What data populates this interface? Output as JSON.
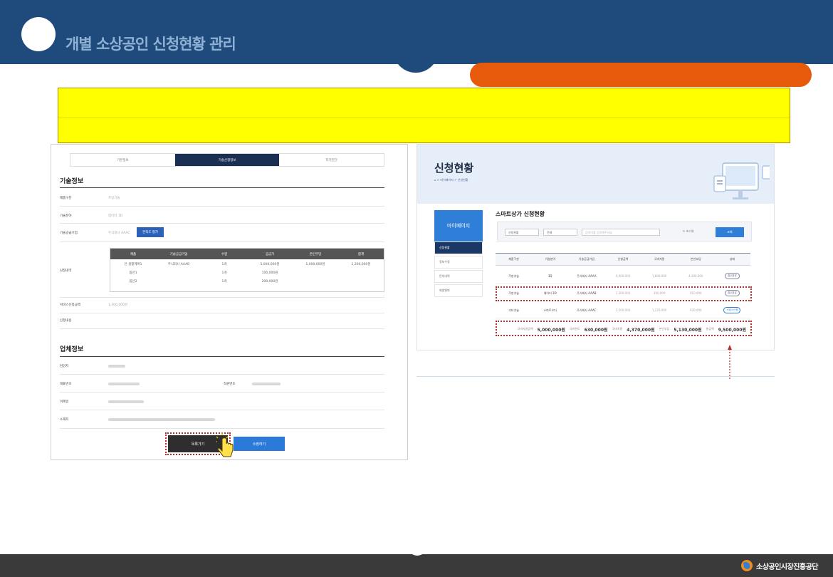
{
  "header": {
    "title": "개별 소상공인 신청현황 관리"
  },
  "left_panel": {
    "tabs": [
      "기본정보",
      "기술신청정보",
      "자가진단"
    ],
    "active_tab": 1,
    "tech_section_title": "기술정보",
    "rows": [
      {
        "label": "제품구분",
        "value": "주방기술"
      },
      {
        "label": "기술분야",
        "value": "데이터 3D"
      },
      {
        "label": "기술공급기업",
        "value": "주식회사 AAAC"
      },
      {
        "label": "신청내역",
        "value": ""
      },
      {
        "label": "서비스신청금액",
        "value": "1,300,000원"
      },
      {
        "label": "신청내용",
        "value": ""
      }
    ],
    "compare_button": "견적도 평가",
    "table": {
      "headers": [
        "제품",
        "기술공급기업",
        "수량",
        "공급가",
        "본인부담",
        "합계"
      ],
      "rows": [
        [
          "안 생활계획1",
          "주식회사 AAAB",
          "1개",
          "5,000,000원",
          "1,000,000원",
          "1,300,000원"
        ],
        [
          "옵션1",
          "",
          "1개",
          "100,000원",
          "",
          ""
        ],
        [
          "옵션2",
          "",
          "1개",
          "200,000원",
          "",
          ""
        ]
      ]
    },
    "company_section_title": "업체정보",
    "company_rows": [
      "담당자",
      "대표번호",
      "직원번호",
      "이메일",
      "소재지"
    ],
    "back_button": "목록가기",
    "edit_button": "수정하기"
  },
  "right_panel": {
    "title": "신청현황",
    "breadcrumb": "⌂ > 마이페이지 > 신청현황",
    "side_menu_title": "마이페이지",
    "side_items": [
      "신청현황",
      "정보수정",
      "문의내역",
      "회원탈퇴"
    ],
    "subtitle": "스마트상가 신청현황",
    "filters": [
      "신청현황",
      "전체",
      "검색어를 입력해주세요"
    ],
    "reset_label": "↻ 초기화",
    "search_button": "조회",
    "table_headers": [
      "제품구분",
      "기술분야",
      "기술공급기업",
      "신청금액",
      "국비지원",
      "본인부담",
      "상태"
    ],
    "rows": [
      [
        "주방기술",
        "3D",
        "주식회사 AAAA",
        "6,000,000",
        "1,800,000",
        "4,200,000",
        "접수완료"
      ],
      [
        "주방기술",
        "데이터 3D",
        "주식회사 AAAB",
        "1,300,000",
        "390,000",
        "910,000",
        "접수완료"
      ],
      [
        "기타기술",
        "스마트오더",
        "주식회사 AAAC",
        "2,200,000",
        "1,270,000",
        "930,000",
        "서비스신청"
      ]
    ],
    "totals": [
      {
        "label": "국비지원금액",
        "value": "5,000,000원"
      },
      {
        "label": "국비한도",
        "value": "630,000원"
      },
      {
        "label": "국비지원",
        "value": "4,370,000원"
      },
      {
        "label": "본인부담",
        "value": "5,130,000원"
      },
      {
        "label": "총금액",
        "value": "9,500,000원"
      }
    ]
  },
  "footer": {
    "org_name": "소상공인시장진흥공단"
  }
}
